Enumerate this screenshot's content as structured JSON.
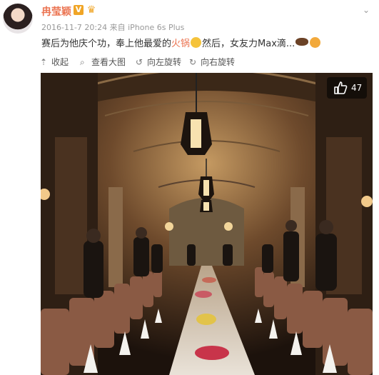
{
  "post": {
    "author": "冉莹颖",
    "verified_badge": "V",
    "timestamp": "2016-11-7 20:24",
    "source_prefix": "来自",
    "source": "iPhone 6s Plus",
    "caption_part1": "赛后为他庆个功，奉上他最爱的",
    "caption_highlight": "火锅",
    "caption_part2": "然后，女友力Max滴...",
    "highlight_color": "#eb7350"
  },
  "toolbar": {
    "collapse": "收起",
    "view_large": "查看大图",
    "rotate_left": "向左旋转",
    "rotate_right": "向右旋转"
  },
  "photo": {
    "like_count": "47"
  },
  "icons": [
    "avatar",
    "verified-icon",
    "crown-icon",
    "chevron-down-icon",
    "collapse-icon",
    "search-icon",
    "rotate-left-icon",
    "rotate-right-icon",
    "thumbs-up-icon"
  ]
}
